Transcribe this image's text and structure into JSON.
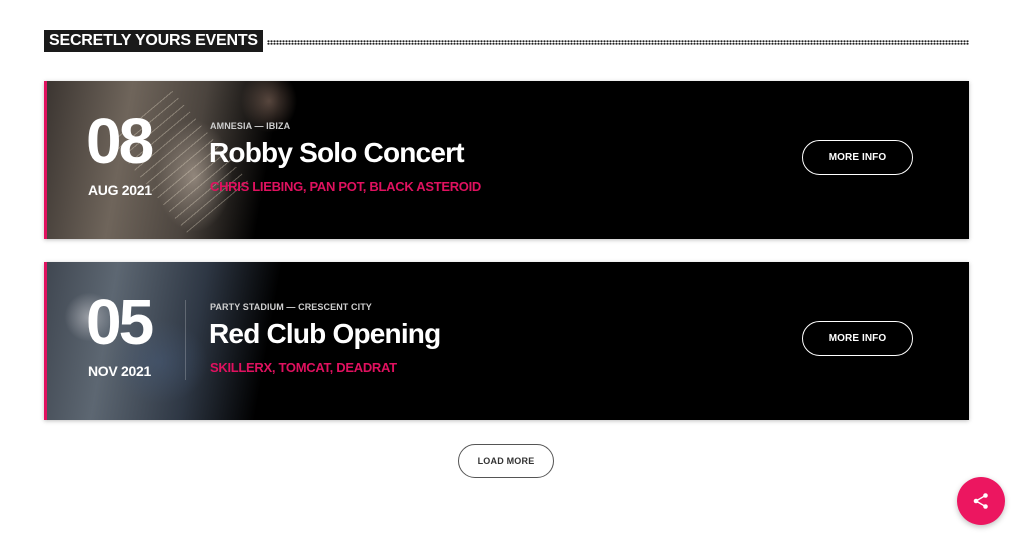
{
  "section": {
    "title": "SECRETLY YOURS EVENTS"
  },
  "events": [
    {
      "day": "08",
      "month_year": "AUG 2021",
      "venue": "AMNESIA — IBIZA",
      "title": "Robby Solo Concert",
      "artists": "CHRIS LIEBING, PAN POT, BLACK ASTEROID",
      "button_label": "MORE INFO"
    },
    {
      "day": "05",
      "month_year": "NOV 2021",
      "venue": "PARTY STADIUM — CRESCENT CITY",
      "title": "Red Club Opening",
      "artists": "SKILLERX, TOMCAT, DEADRAT",
      "button_label": "MORE INFO"
    }
  ],
  "load_more": {
    "label": "LOAD MORE"
  },
  "share": {
    "icon": "share-icon"
  },
  "colors": {
    "accent": "#e0115f",
    "card_background": "#000000",
    "fab": "#ec1660"
  }
}
